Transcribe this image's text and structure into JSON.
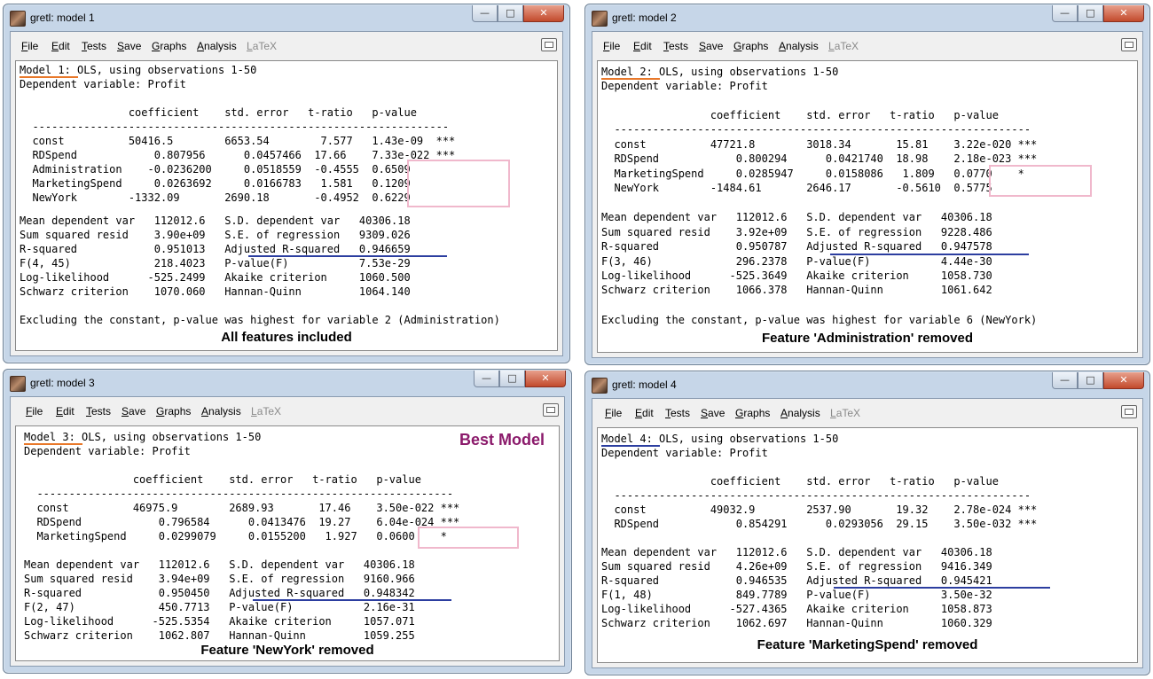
{
  "menu": [
    {
      "label": "File",
      "underline": "F",
      "rest": "ile",
      "enabled": true
    },
    {
      "label": "Edit",
      "underline": "E",
      "rest": "dit",
      "enabled": true
    },
    {
      "label": "Tests",
      "underline": "T",
      "rest": "ests",
      "enabled": true
    },
    {
      "label": "Save",
      "underline": "S",
      "rest": "ave",
      "enabled": true
    },
    {
      "label": "Graphs",
      "underline": "G",
      "rest": "raphs",
      "enabled": true
    },
    {
      "label": "Analysis",
      "underline": "A",
      "rest": "nalysis",
      "enabled": true
    },
    {
      "label": "LaTeX",
      "underline": "L",
      "rest": "aTeX",
      "enabled": false
    }
  ],
  "windows": [
    {
      "title": "gretl: model 1",
      "lines": [
        "Model 1: OLS, using observations 1-50",
        "Dependent variable: Profit",
        "",
        "                 coefficient    std. error   t-ratio   p-value",
        "  -----------------------------------------------------------------",
        "  const          50416.5        6653.54        7.577   1.43e-09  ***",
        "  RDSpend            0.807956      0.0457466  17.66    7.33e-022 ***",
        "  Administration    -0.0236200     0.0518559  -0.4555  0.6509",
        "  MarketingSpend     0.0263692     0.0166783   1.581   0.1209",
        "  NewYork        -1332.09       2690.18       -0.4952  0.6229",
        "",
        "Mean dependent var   112012.6   S.D. dependent var   40306.18",
        "Sum squared resid    3.90e+09   S.E. of regression   9309.026",
        "R-squared            0.951013   Adjusted R-squared   0.946659",
        "F(4, 45)             218.4023   P-value(F)           7.53e-29",
        "Log-likelihood      -525.2499   Akaike criterion     1060.500",
        "Schwarz criterion    1070.060   Hannan-Quinn         1064.140",
        "",
        "Excluding the constant, p-value was highest for variable 2 (Administration)"
      ],
      "caption": "All features included",
      "best_label": ""
    },
    {
      "title": "gretl: model 2",
      "lines": [
        "Model 2: OLS, using observations 1-50",
        "Dependent variable: Profit",
        "",
        "                 coefficient    std. error   t-ratio   p-value",
        "  -----------------------------------------------------------------",
        "  const          47721.8        3018.34       15.81    3.22e-020 ***",
        "  RDSpend            0.800294      0.0421740  18.98    2.18e-023 ***",
        "  MarketingSpend     0.0285947     0.0158086   1.809   0.0770    *",
        "  NewYork        -1484.61       2646.17       -0.5610  0.5775",
        "",
        "Mean dependent var   112012.6   S.D. dependent var   40306.18",
        "Sum squared resid    3.92e+09   S.E. of regression   9228.486",
        "R-squared            0.950787   Adjusted R-squared   0.947578",
        "F(3, 46)             296.2378   P-value(F)           4.44e-30",
        "Log-likelihood      -525.3649   Akaike criterion     1058.730",
        "Schwarz criterion    1066.378   Hannan-Quinn         1061.642",
        "",
        "Excluding the constant, p-value was highest for variable 6 (NewYork)"
      ],
      "caption": "Feature 'Administration' removed",
      "best_label": ""
    },
    {
      "title": "gretl: model 3",
      "lines": [
        "Model 3: OLS, using observations 1-50",
        "Dependent variable: Profit",
        "",
        "                 coefficient    std. error   t-ratio   p-value",
        "  -----------------------------------------------------------------",
        "  const          46975.9        2689.93       17.46    3.50e-022 ***",
        "  RDSpend            0.796584      0.0413476  19.27    6.04e-024 ***",
        "  MarketingSpend     0.0299079     0.0155200   1.927   0.0600    *",
        "",
        "Mean dependent var   112012.6   S.D. dependent var   40306.18",
        "Sum squared resid    3.94e+09   S.E. of regression   9160.966",
        "R-squared            0.950450   Adjusted R-squared   0.948342",
        "F(2, 47)             450.7713   P-value(F)           2.16e-31",
        "Log-likelihood      -525.5354   Akaike criterion     1057.071",
        "Schwarz criterion    1062.807   Hannan-Quinn         1059.255"
      ],
      "caption": "Feature 'NewYork' removed",
      "best_label": "Best Model"
    },
    {
      "title": "gretl: model 4",
      "lines": [
        "Model 4: OLS, using observations 1-50",
        "Dependent variable: Profit",
        "",
        "                 coefficient    std. error   t-ratio   p-value",
        "  -----------------------------------------------------------------",
        "  const          49032.9        2537.90       19.32    2.78e-024 ***",
        "  RDSpend            0.854291      0.0293056  29.15    3.50e-032 ***",
        "",
        "Mean dependent var   112012.6   S.D. dependent var   40306.18",
        "Sum squared resid    4.26e+09   S.E. of regression   9416.349",
        "R-squared            0.946535   Adjusted R-squared   0.945421",
        "F(1, 48)             849.7789   P-value(F)           3.50e-32",
        "Log-likelihood      -527.4365   Akaike criterion     1058.873",
        "Schwarz criterion    1062.697   Hannan-Quinn         1060.329"
      ],
      "caption": "Feature 'MarketingSpend' removed",
      "best_label": ""
    }
  ],
  "colors": {
    "model_underline": "#e8782a",
    "model4_underline": "#2c3ea0",
    "adj_r2_underline": "#2c3ea0",
    "highlight_box": "#f0b8cc",
    "best_label": "#8b1a6b"
  }
}
